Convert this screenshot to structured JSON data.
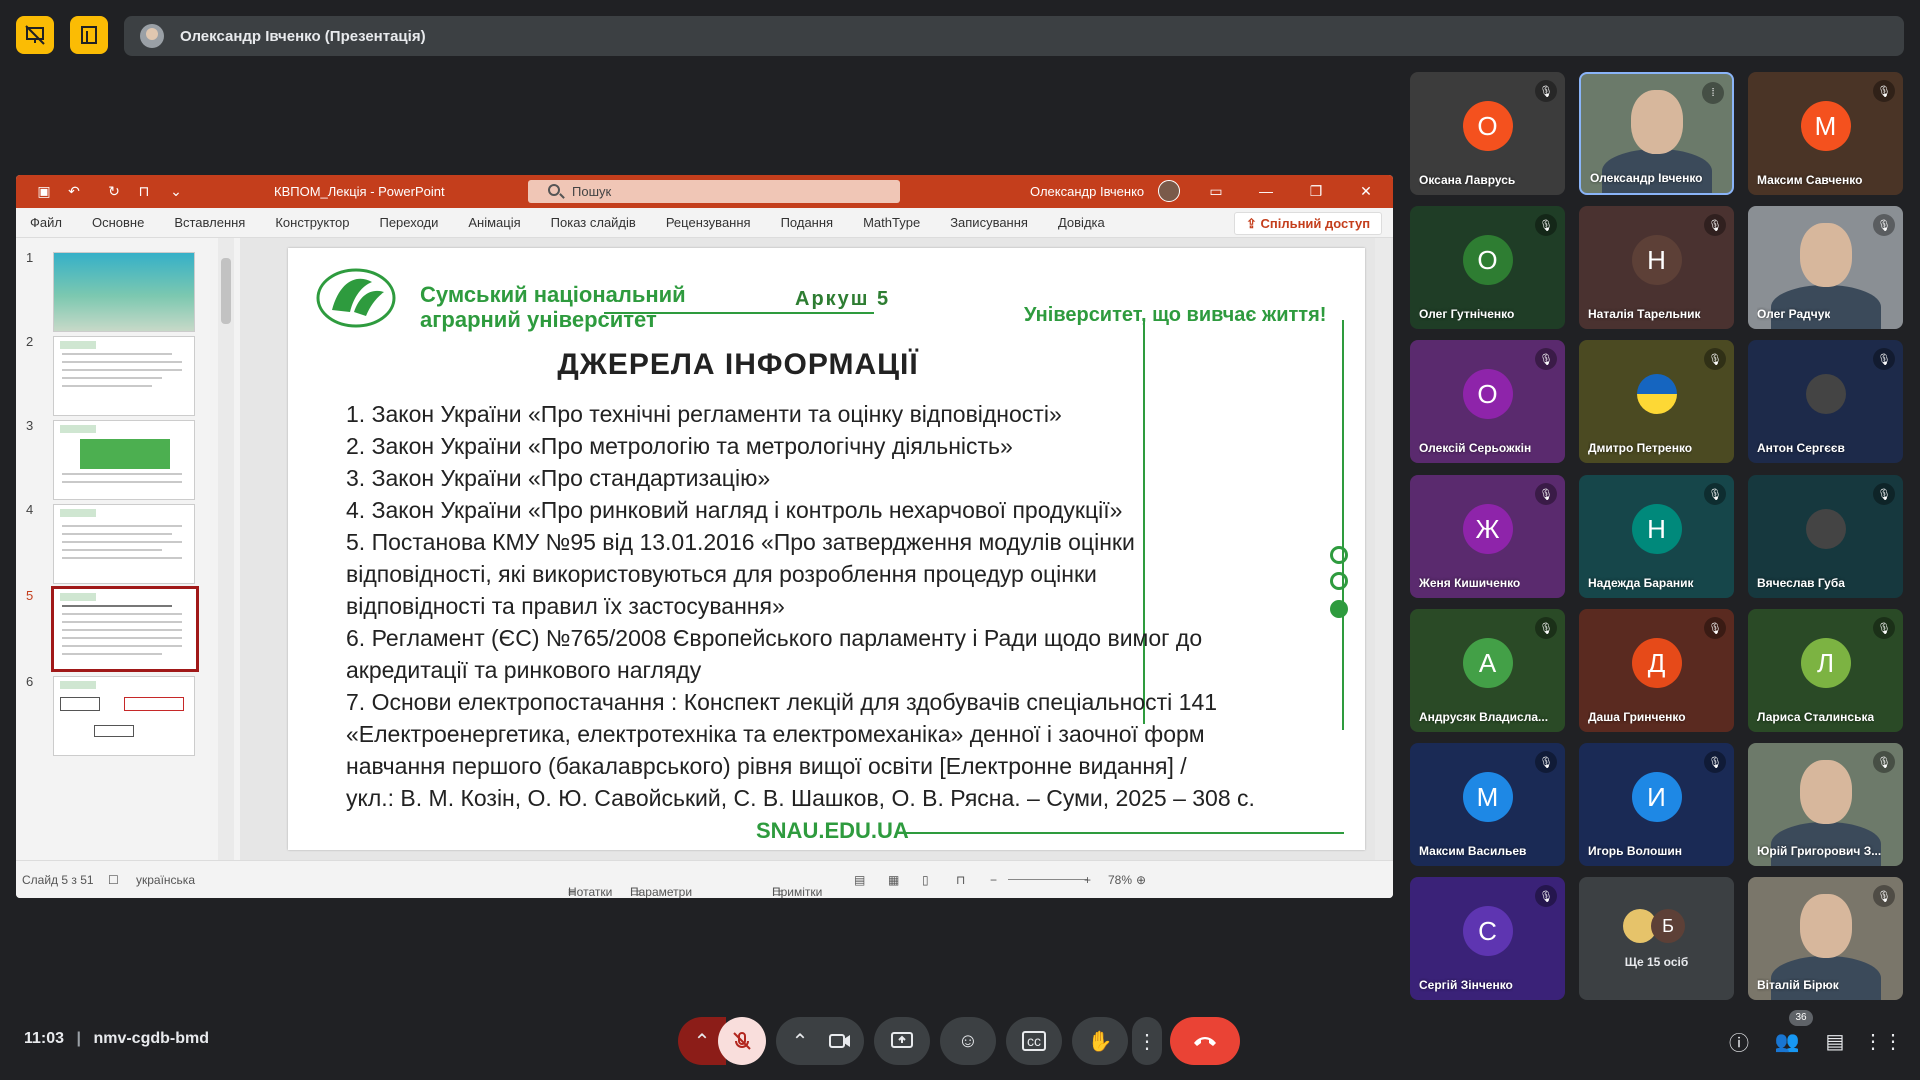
{
  "meet": {
    "presenter_label": "Олександр Івченко (Презентація)",
    "time": "11:03",
    "meeting_code": "nmv-cgdb-bmd",
    "people_count": "36",
    "more_people": "Ще 15 осіб"
  },
  "ppt": {
    "doc_title": "КВПОМ_Лекція  -  PowerPoint",
    "search_placeholder": "Пошук",
    "user": "Олександр Івченко",
    "tabs": [
      "Файл",
      "Основне",
      "Вставлення",
      "Конструктор",
      "Переходи",
      "Анімація",
      "Показ слайдів",
      "Рецензування",
      "Подання",
      "MathType",
      "Записування",
      "Довідка"
    ],
    "share": "Спільний доступ",
    "thumb_numbers": [
      "1",
      "2",
      "3",
      "4",
      "5",
      "6"
    ],
    "status": {
      "slide": "Слайд 5 з 51",
      "language": "українська",
      "notes": "Нотатки",
      "display": "Параметри відображення",
      "comments": "Примітки",
      "zoom": "78%"
    }
  },
  "slide": {
    "university_line1": "Сумський національний",
    "university_line2": "аграрний університет",
    "sheet": "Аркуш 5",
    "slogan": "Університет, що вивчає життя!",
    "heading": "ДЖЕРЕЛА ІНФОРМАЦІЇ",
    "lines": [
      "1. Закон України «Про технічні регламенти та оцінку відповідності»",
      "2. Закон України «Про метрологію та метрологічну діяльність»",
      "3. Закон України «Про стандартизацію»",
      "4. Закон України «Про ринковий нагляд і контроль нехарчової продукції»",
      "5. Постанова КМУ №95 від 13.01.2016 «Про затвердження модулів оцінки",
      "відповідності, які використовуються для розроблення процедур оцінки",
      "відповідності та правил їх застосування»",
      "6. Регламент (ЄС) №765/2008 Європейського парламенту і Ради щодо вимог до",
      "акредитації та ринкового нагляду",
      "7. Основи електропостачання : Конспект лекцій для здобувачів спеціальності 141",
      "«Електроенергетика, електротехніка та електромеханіка» денної і заочної форм",
      "навчання першого (бакалаврського) рівня вищої освіти [Електронне видання] /",
      "укл.: В. М. Козін, О. Ю. Савойський, С. В. Шашков, О. В. Рясна. – Суми, 2025 – 308 с."
    ],
    "site": "SNAU.EDU.UA"
  },
  "participants": [
    {
      "name": "Оксана Лаврусь",
      "initial": "О",
      "bg": "#3c3c3c",
      "circle": "#f4511e"
    },
    {
      "name": "Олександр Івченко",
      "initial": "",
      "bg": "#6b7a6a",
      "circle": ""
    },
    {
      "name": "Максим Савченко",
      "initial": "М",
      "bg": "#4a3426",
      "circle": "#f4511e"
    },
    {
      "name": "Олег Гутніченко",
      "initial": "О",
      "bg": "#1f3d26",
      "circle": "#2e7d32"
    },
    {
      "name": "Наталія Тарельник",
      "initial": "Н",
      "bg": "#4a3230",
      "circle": "#5d4037"
    },
    {
      "name": "Олег Радчук",
      "initial": "",
      "bg": "#8a8f94",
      "circle": ""
    },
    {
      "name": "Олексій Серьожкін",
      "initial": "О",
      "bg": "#5a2a6e",
      "circle": "#8e24aa"
    },
    {
      "name": "Дмитро Петренко",
      "initial": "",
      "bg": "#4b4a22",
      "circle": ""
    },
    {
      "name": "Антон Сергєєв",
      "initial": "",
      "bg": "#1d2a4a",
      "circle": ""
    },
    {
      "name": "Женя Кишиченко",
      "initial": "Ж",
      "bg": "#5a2a6e",
      "circle": "#8e24aa"
    },
    {
      "name": "Надежда Бараник",
      "initial": "Н",
      "bg": "#16464a",
      "circle": "#00897b"
    },
    {
      "name": "Вячеслав Губа",
      "initial": "",
      "bg": "#16383e",
      "circle": ""
    },
    {
      "name": "Андрусяк Владисла...",
      "initial": "А",
      "bg": "#2a4a26",
      "circle": "#43a047"
    },
    {
      "name": "Даша Гринченко",
      "initial": "Д",
      "bg": "#5a2a20",
      "circle": "#e64a19"
    },
    {
      "name": "Лариса Сталинська",
      "initial": "Л",
      "bg": "#2a4a26",
      "circle": "#7cb342"
    },
    {
      "name": "Максим Васильев",
      "initial": "М",
      "bg": "#1a2a55",
      "circle": "#1e88e5"
    },
    {
      "name": "Игорь Волошин",
      "initial": "И",
      "bg": "#1a2a55",
      "circle": "#1e88e5"
    },
    {
      "name": "Юрій Григорович З...",
      "initial": "",
      "bg": "#6d7a6a",
      "circle": ""
    },
    {
      "name": "Сергій Зінченко",
      "initial": "С",
      "bg": "#3a2278",
      "circle": "#5e35b1"
    },
    {
      "name": "",
      "initial": "",
      "bg": "#3c4043",
      "circle": ""
    },
    {
      "name": "Віталій Бірюк",
      "initial": "",
      "bg": "#7a766a",
      "circle": ""
    }
  ]
}
